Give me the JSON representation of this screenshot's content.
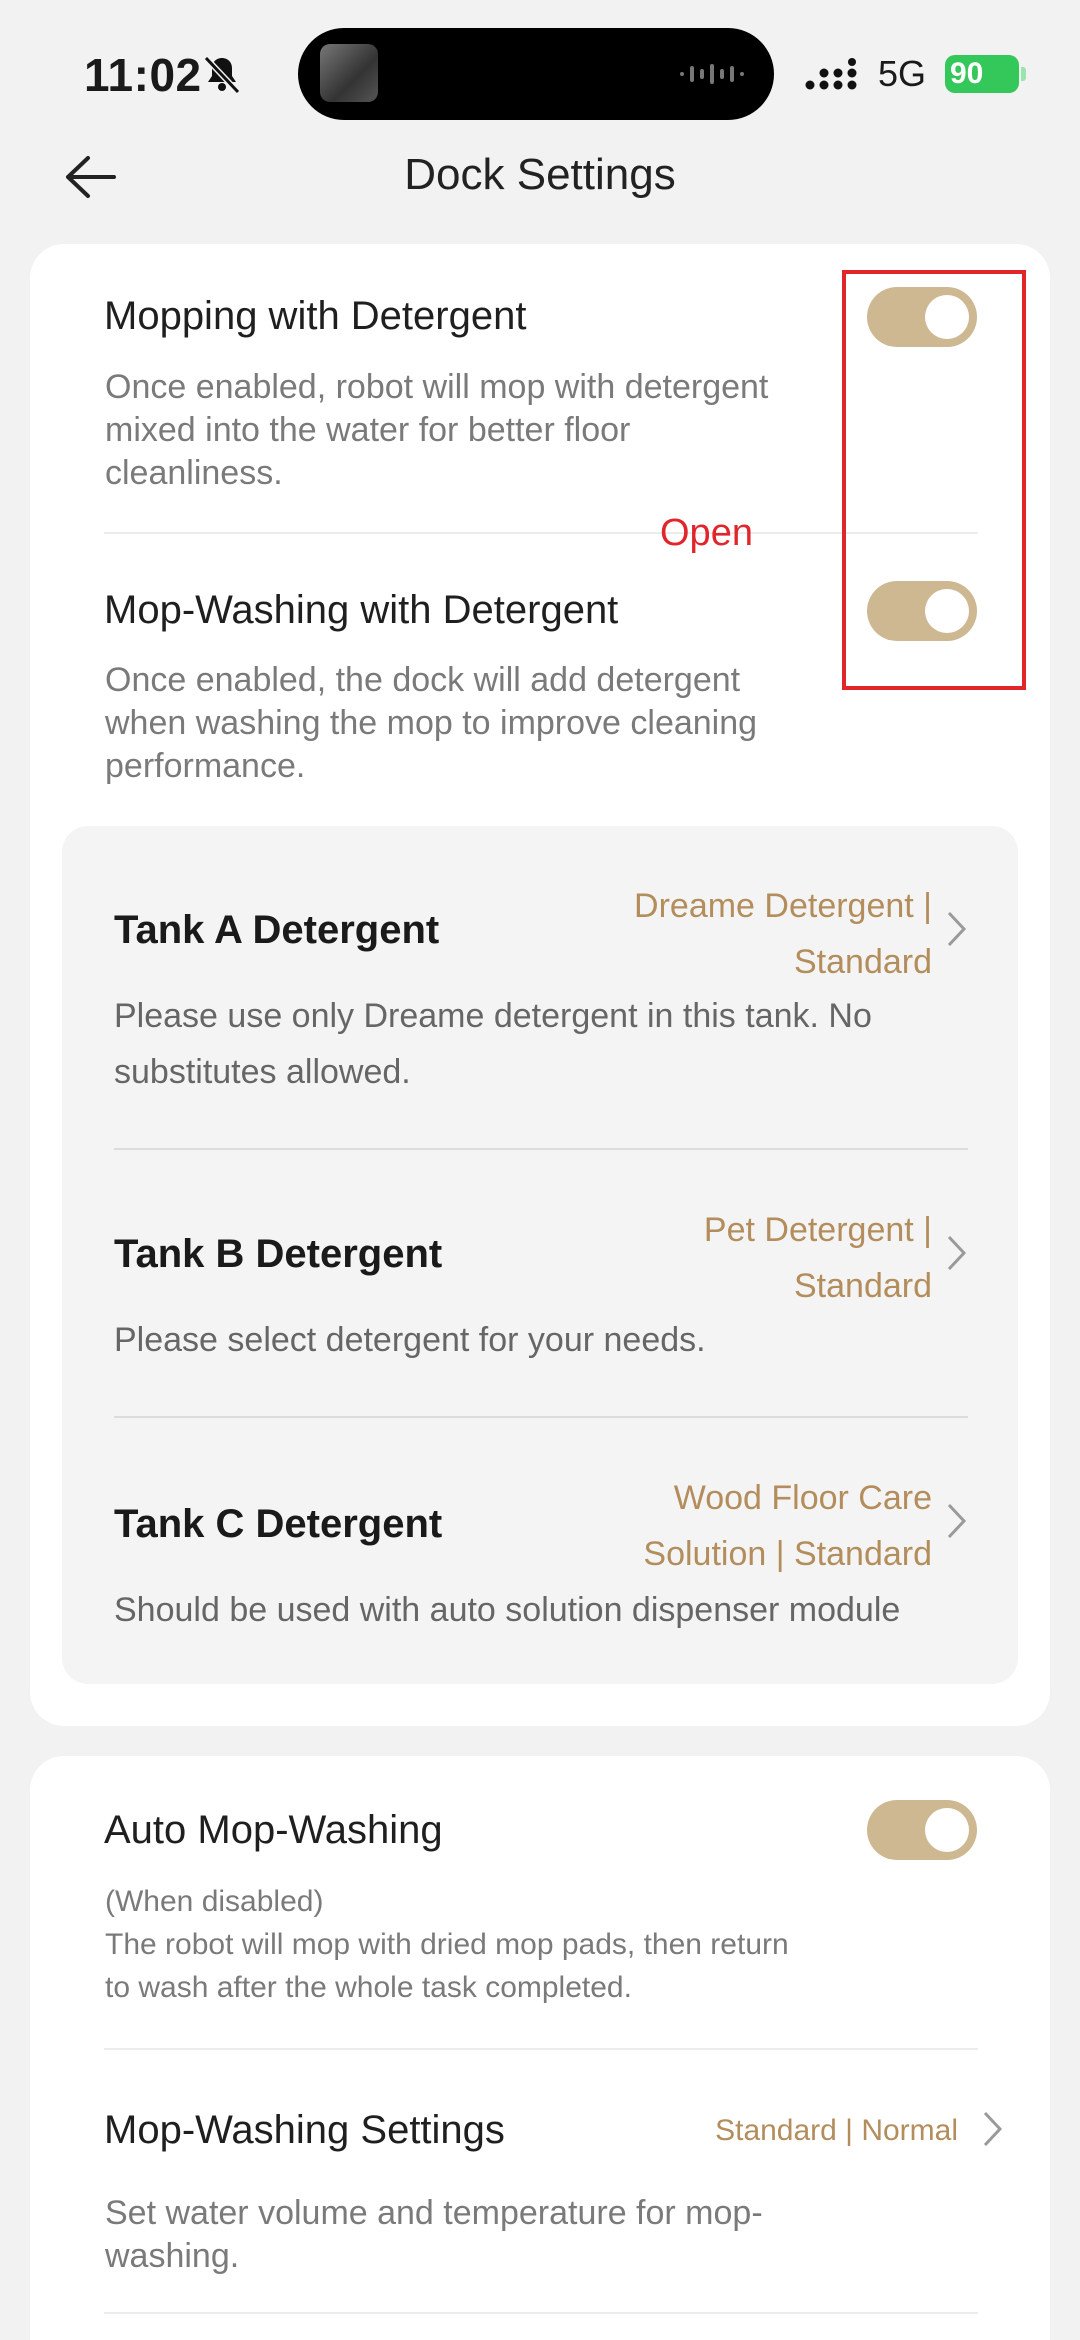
{
  "status_bar": {
    "time": "11:02",
    "network": "5G",
    "battery": "90"
  },
  "header": {
    "title": "Dock Settings"
  },
  "detergent_section": {
    "mopping": {
      "title": "Mopping with Detergent",
      "description_lines": [
        "Once enabled, robot will mop with detergent",
        "mixed into the water for better floor",
        "cleanliness."
      ],
      "enabled": true
    },
    "mop_washing": {
      "title": "Mop-Washing with Detergent",
      "description_lines": [
        "Once enabled, the dock will add detergent",
        "when washing the mop to improve cleaning",
        "performance."
      ],
      "enabled": true
    },
    "tanks": [
      {
        "title": "Tank A Detergent",
        "value_lines": [
          "Dreame Detergent |",
          "Standard"
        ],
        "description_lines": [
          "Please use only Dreame detergent in this tank. No",
          "substitutes allowed."
        ]
      },
      {
        "title": "Tank B Detergent",
        "value_lines": [
          "Pet Detergent |",
          "Standard"
        ],
        "description_lines": [
          "Please select detergent for your needs."
        ]
      },
      {
        "title": "Tank C Detergent",
        "value_lines": [
          "Wood Floor Care",
          "Solution | Standard"
        ],
        "description_lines": [
          "Should be used with auto solution dispenser module"
        ]
      }
    ]
  },
  "wash_section": {
    "auto_mop_washing": {
      "title": "Auto Mop-Washing",
      "description_lines": [
        "(When disabled)",
        "The robot will mop with dried mop pads, then return",
        "to wash after the whole task completed."
      ],
      "enabled": true
    },
    "mop_washing_settings": {
      "title": "Mop-Washing Settings",
      "value": "Standard | Normal",
      "description_lines": [
        "Set water volume and temperature for mop-",
        "washing."
      ]
    }
  },
  "annotation": {
    "label": "Open",
    "color": "#e1262b"
  },
  "colors": {
    "accent": "#b38d5c",
    "toggle_on": "#cdb892",
    "background": "#f2f2f2"
  }
}
